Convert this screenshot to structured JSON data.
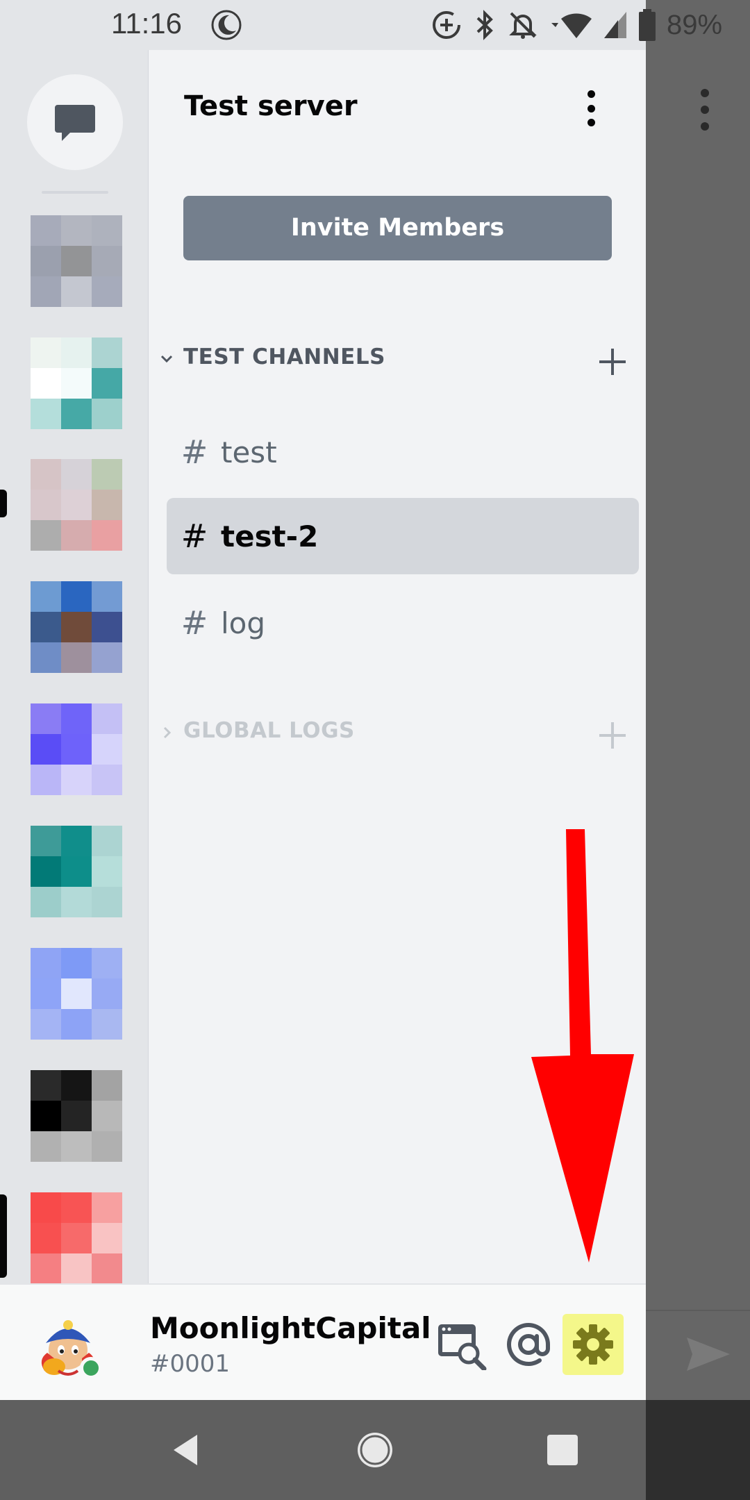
{
  "status_bar": {
    "time": "11:16",
    "battery": "89%",
    "icons": [
      "moon-icon",
      "data-saver-icon",
      "bluetooth-icon",
      "notifications-off-icon",
      "wifi-icon",
      "signal-icon",
      "battery-icon"
    ]
  },
  "server": {
    "name": "Test server",
    "invite_label": "Invite Members"
  },
  "categories": [
    {
      "name": "TEST CHANNELS",
      "expanded": true,
      "color": "#4f5660",
      "channels": [
        {
          "name": "test",
          "selected": false
        },
        {
          "name": "test-2",
          "selected": true
        },
        {
          "name": "log",
          "selected": false
        }
      ]
    },
    {
      "name": "GLOBAL LOGS",
      "expanded": false,
      "color": "#c4c9ce",
      "channels": []
    }
  ],
  "channel_prefix": "#",
  "user": {
    "name": "MoonlightCapital",
    "discriminator": "#0001",
    "status_color": "#3ba55d"
  },
  "userbar_icons": [
    "server-discovery-icon",
    "mention-icon",
    "gear-icon"
  ],
  "annotation": {
    "type": "red-arrow-pointing-down",
    "color": "#ff0000"
  }
}
